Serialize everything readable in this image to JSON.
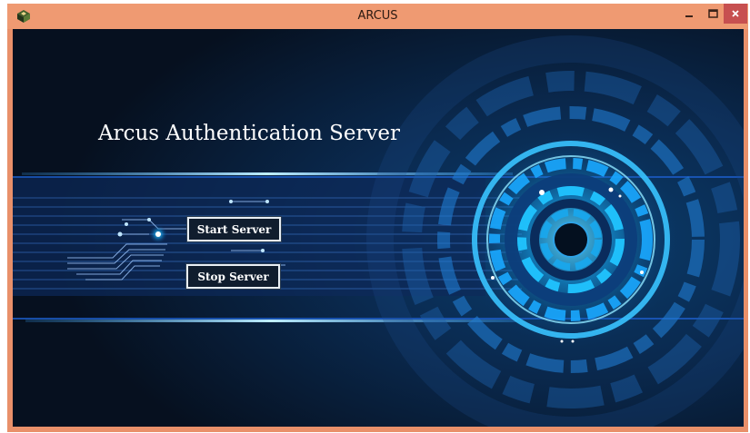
{
  "window": {
    "title": "ARCUS",
    "app_icon": "arcus-cube-icon",
    "controls": {
      "minimize": "minimize-icon",
      "maximize": "maximize-icon",
      "close": "close-icon"
    }
  },
  "main": {
    "heading": "Arcus Authentication Server",
    "buttons": {
      "start_label": "Start Server",
      "stop_label": "Stop Server"
    }
  },
  "colors": {
    "titlebar": "#ef9a72",
    "close_button": "#c75050",
    "background": "#0a1a30",
    "accent_glow": "#1ec8ff"
  }
}
